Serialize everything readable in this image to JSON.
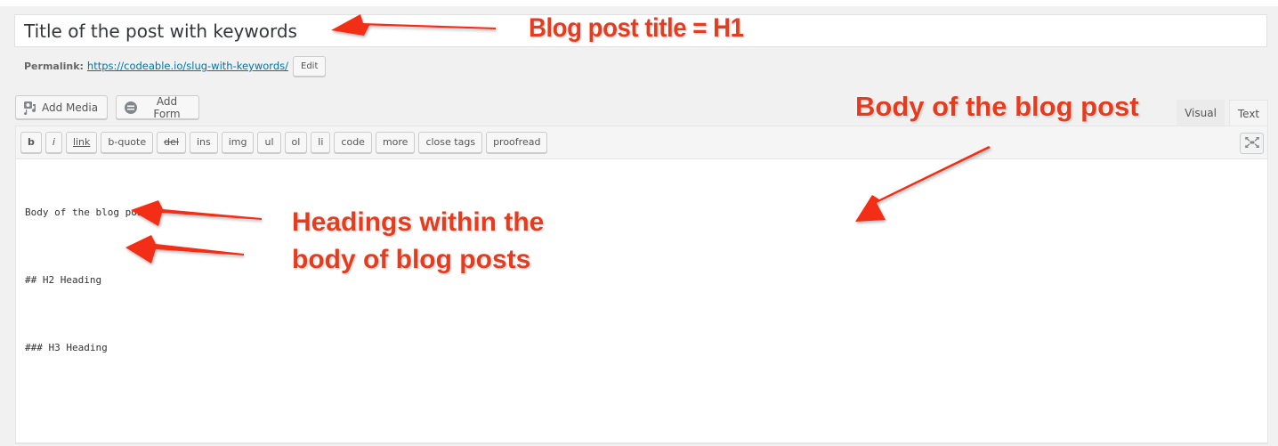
{
  "title_field": {
    "value": "Title of the post with keywords"
  },
  "permalink": {
    "label": "Permalink:",
    "url": "https://codeable.io/slug-with-keywords/",
    "edit_label": "Edit"
  },
  "media_buttons": {
    "add_media": {
      "label": "Add Media",
      "icon": "media-icon"
    },
    "add_form": {
      "label": "Add Form",
      "icon": "form-icon"
    }
  },
  "editor_tabs": [
    {
      "label": "Visual",
      "active": false
    },
    {
      "label": "Text",
      "active": true
    }
  ],
  "quicktags": [
    "b",
    "i",
    "link",
    "b-quote",
    "del",
    "ins",
    "img",
    "ul",
    "ol",
    "li",
    "code",
    "more",
    "close tags",
    "proofread"
  ],
  "fullscreen": {
    "icon": "fullscreen-icon"
  },
  "editor_content": {
    "lines": [
      "Body of the blog post",
      "## H2 Heading",
      "### H3 Heading"
    ]
  },
  "annotations": {
    "title": "Blog post title = H1",
    "body": "Body of the blog post",
    "headings_line1": "Headings within the",
    "headings_line2": "body of blog posts",
    "color": "#e53c1f"
  }
}
